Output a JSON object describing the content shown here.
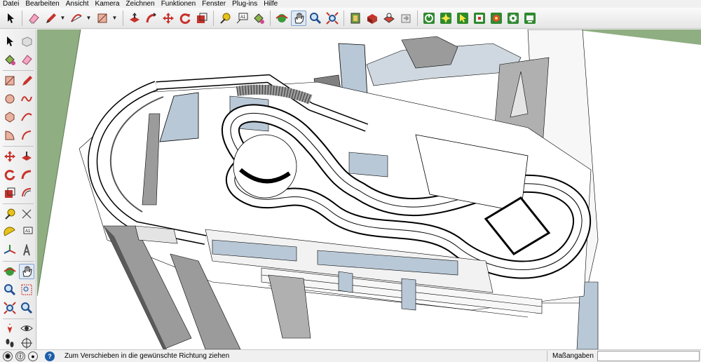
{
  "menu": [
    "Datei",
    "Bearbeiten",
    "Ansicht",
    "Kamera",
    "Zeichnen",
    "Funktionen",
    "Fenster",
    "Plug-ins",
    "Hilfe"
  ],
  "toolbar": {
    "groups": [
      [
        "select-icon",
        "eraser-icon",
        "pencil-icon",
        "arc-icon",
        "rectangle-icon"
      ],
      [
        "push-pull-icon",
        "follow-me-icon",
        "move-icon",
        "rotate-icon",
        "scale-icon"
      ],
      [
        "tape-measure-icon",
        "text-icon",
        "paint-bucket-icon"
      ],
      [
        "orbit-icon",
        "pan-icon",
        "zoom-icon",
        "zoom-extents-icon"
      ],
      [
        "model-info-icon",
        "components-icon",
        "materials-icon",
        "styles-icon"
      ],
      [
        "plugin-green-icon",
        "plugin-star-icon",
        "plugin-pointer-icon",
        "plugin-cube-icon",
        "plugin-color-icon",
        "plugin-gear-icon",
        "plugin-screen-icon"
      ]
    ],
    "active": "pan-icon"
  },
  "status": {
    "message": "Zum Verschieben in die gewünschte Richtung ziehen",
    "measurements_label": "Maßangaben",
    "measurements_value": ""
  },
  "colors": {
    "ground": "#8fae82",
    "sky": "#ffffff",
    "face_front": "#ffffff",
    "face_back": "#b9c8d6",
    "edge": "#000000",
    "wall_side": "#9b9b9b",
    "active_button": "#dfe9f5"
  }
}
